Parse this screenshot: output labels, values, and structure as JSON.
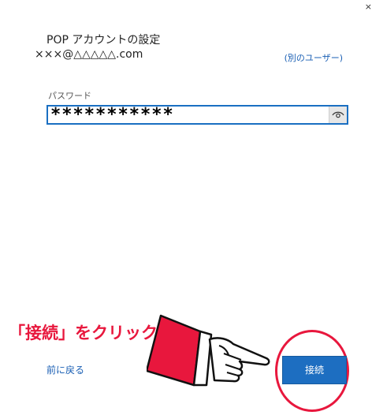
{
  "window": {
    "close_glyph": "×"
  },
  "header": {
    "title": "POP アカウントの設定",
    "account": "×××@△△△△△.com",
    "other_user_link": "(別のユーザー)"
  },
  "password": {
    "label": "パスワード",
    "value": "***********",
    "reveal_icon": "eye-icon"
  },
  "annotation": {
    "text": "「接続」をクリック",
    "color": "#e8173d",
    "pointer_icon": "pointing-hand-icon"
  },
  "footer": {
    "back_link": "前に戻る",
    "connect_button": "接続"
  },
  "colors": {
    "accent": "#1d6ec1",
    "link": "#1a5fb4",
    "annotation": "#e8173d"
  }
}
